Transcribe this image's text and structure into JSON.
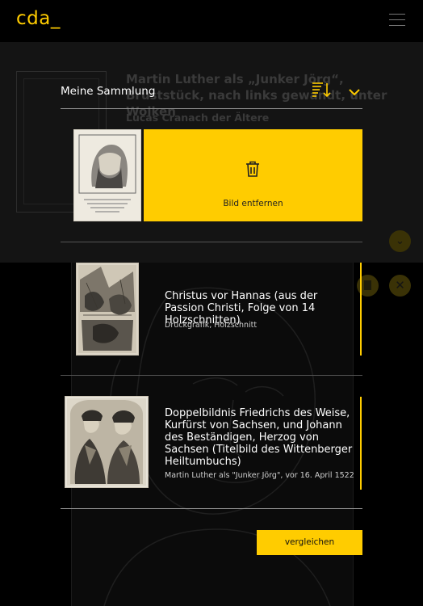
{
  "app": {
    "logo": "cda_"
  },
  "background_page": {
    "title": "Martin Luther als „Junker Jörg“, Bruststück, nach links gewandt, unter Wolken",
    "artist": "Lucas Cranach der Ältere"
  },
  "collection": {
    "title": "Meine Sammlung",
    "sort_icon": "sort-descending-icon",
    "toggle_icon": "chevron-down-icon",
    "remove_label": "Bild entfernen",
    "items": [
      {
        "title": "Christus vor Hannas (aus der Passion Christi, Folge von 14 Holzschnitten)",
        "meta": "Druckgrafik, Holzschnitt"
      },
      {
        "title": "Doppelbildnis Friedrichs des Weise, Kurfürst von Sachsen, und Johann des Beständigen, Herzog von Sachsen (Titelbild des Wittenberger Heiltumbuchs)",
        "meta": "Martin Luther als \"Junker Jörg\", vor 16. April 1522"
      }
    ],
    "compare_label": "vergleichen"
  },
  "colors": {
    "accent": "#ffcc00",
    "background": "#000000",
    "divider": "#555555"
  }
}
